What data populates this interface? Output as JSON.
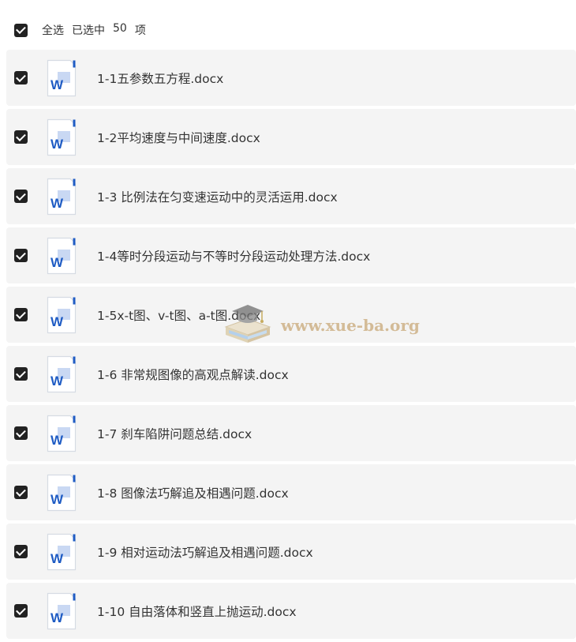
{
  "header": {
    "select_all_label": "全选",
    "selected_label": "已选中",
    "selected_count": "50",
    "unit_label": "项"
  },
  "files": [
    {
      "name": "1-1五参数五方程.docx",
      "icon": "word-doc-icon",
      "checked": true
    },
    {
      "name": "1-2平均速度与中间速度.docx",
      "icon": "word-doc-icon",
      "checked": true
    },
    {
      "name": "1-3 比例法在匀变速运动中的灵活运用.docx",
      "icon": "word-doc-icon",
      "checked": true
    },
    {
      "name": "1-4等时分段运动与不等时分段运动处理方法.docx",
      "icon": "word-doc-icon",
      "checked": true
    },
    {
      "name": "1-5x-t图、v-t图、a-t图.docx",
      "icon": "word-doc-icon",
      "checked": true
    },
    {
      "name": "1-6 非常规图像的高观点解读.docx",
      "icon": "word-doc-icon",
      "checked": true
    },
    {
      "name": "1-7 刹车陷阱问题总结.docx",
      "icon": "word-doc-icon",
      "checked": true
    },
    {
      "name": "1-8 图像法巧解追及相遇问题.docx",
      "icon": "word-doc-icon",
      "checked": true
    },
    {
      "name": "1-9 相对运动法巧解追及相遇问题.docx",
      "icon": "word-doc-icon",
      "checked": true
    },
    {
      "name": "1-10 自由落体和竖直上抛运动.docx",
      "icon": "word-doc-icon",
      "checked": true
    }
  ],
  "watermark": {
    "text": "www.xue-ba.org",
    "icon": "graduation-cap-book-icon"
  },
  "colors": {
    "checkbox": "#222222",
    "row_background": "#f4f4f4",
    "word_blue": "#1f5cc4",
    "word_light": "#c9d8f3",
    "watermark": "#c9a878"
  }
}
